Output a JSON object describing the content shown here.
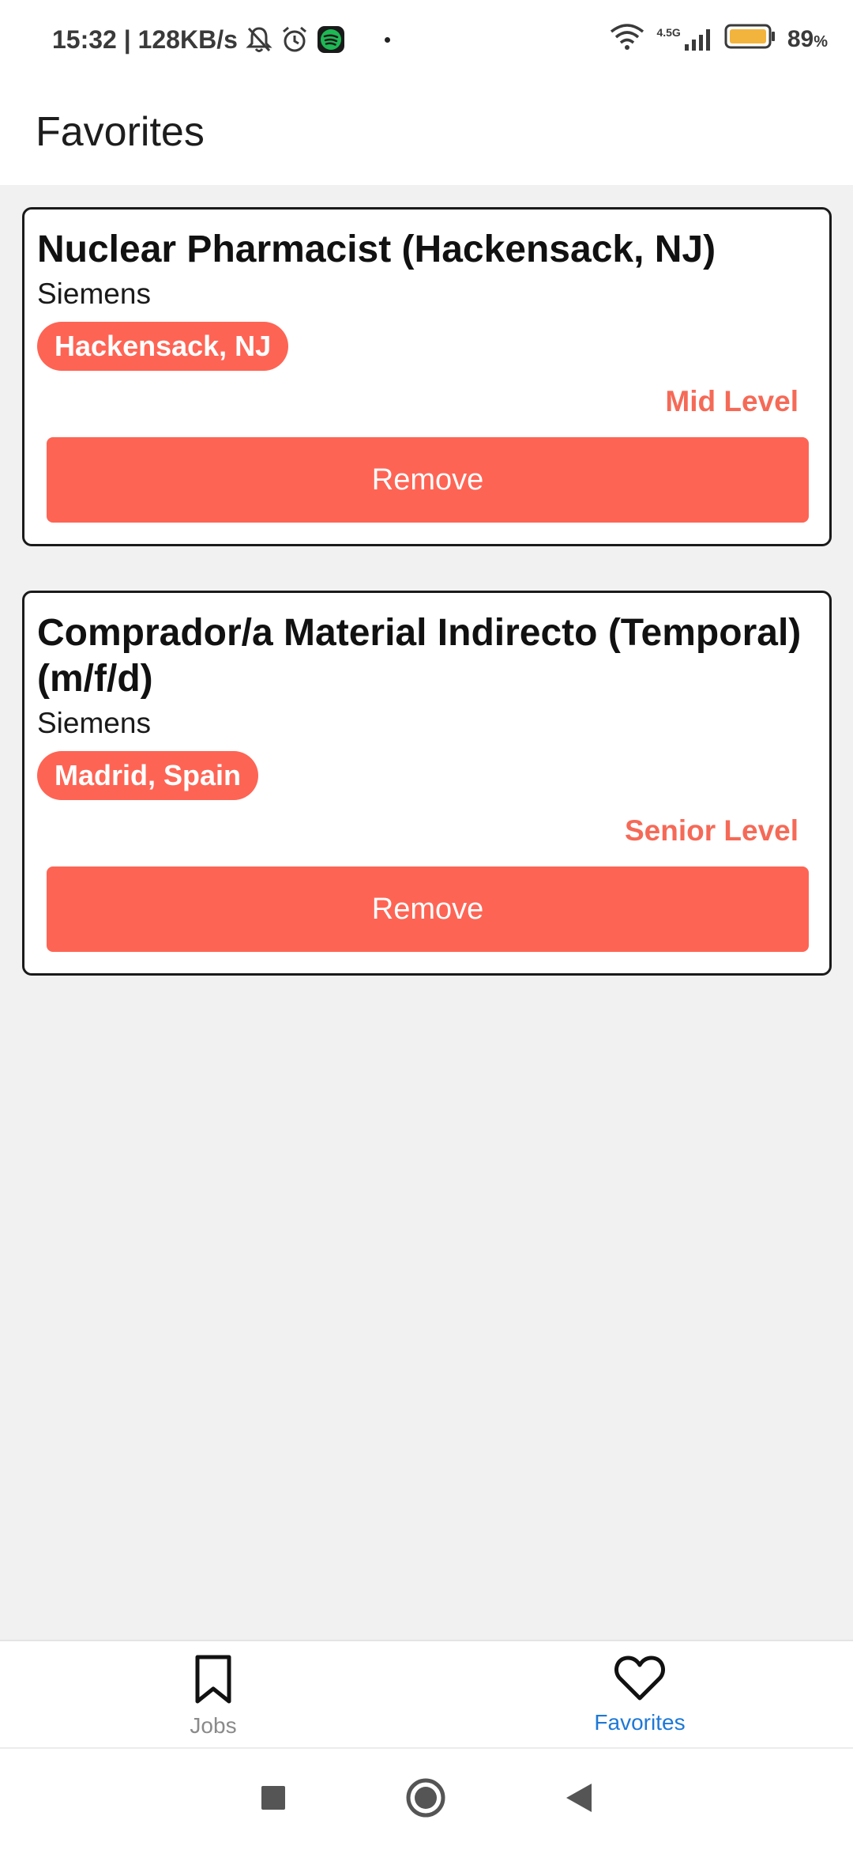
{
  "status_bar": {
    "time_speed": "15:32 | 128KB/s",
    "network": "4.5G",
    "battery": "89",
    "battery_unit": "%"
  },
  "header": {
    "title": "Favorites"
  },
  "jobs": [
    {
      "title": "Nuclear Pharmacist (Hackensack, NJ)",
      "company": "Siemens",
      "location": "Hackensack, NJ",
      "level": "Mid Level",
      "remove_label": "Remove"
    },
    {
      "title": "Comprador/a Material Indirecto (Temporal) (m/f/d)",
      "company": "Siemens",
      "location": "Madrid, Spain",
      "level": "Senior Level",
      "remove_label": "Remove"
    }
  ],
  "bottom_nav": {
    "jobs_label": "Jobs",
    "favorites_label": "Favorites"
  },
  "colors": {
    "accent": "#fe6454",
    "active_nav": "#1e78d7"
  },
  "icons": {
    "bell_off": "bell-off-icon",
    "alarm": "alarm-icon",
    "spotify": "spotify-icon",
    "wifi": "wifi-icon",
    "signal": "signal-icon",
    "battery": "battery-icon",
    "bookmark": "bookmark-icon",
    "heart": "heart-icon",
    "recents": "square-recents-icon",
    "home": "circle-home-icon",
    "back": "triangle-back-icon"
  }
}
